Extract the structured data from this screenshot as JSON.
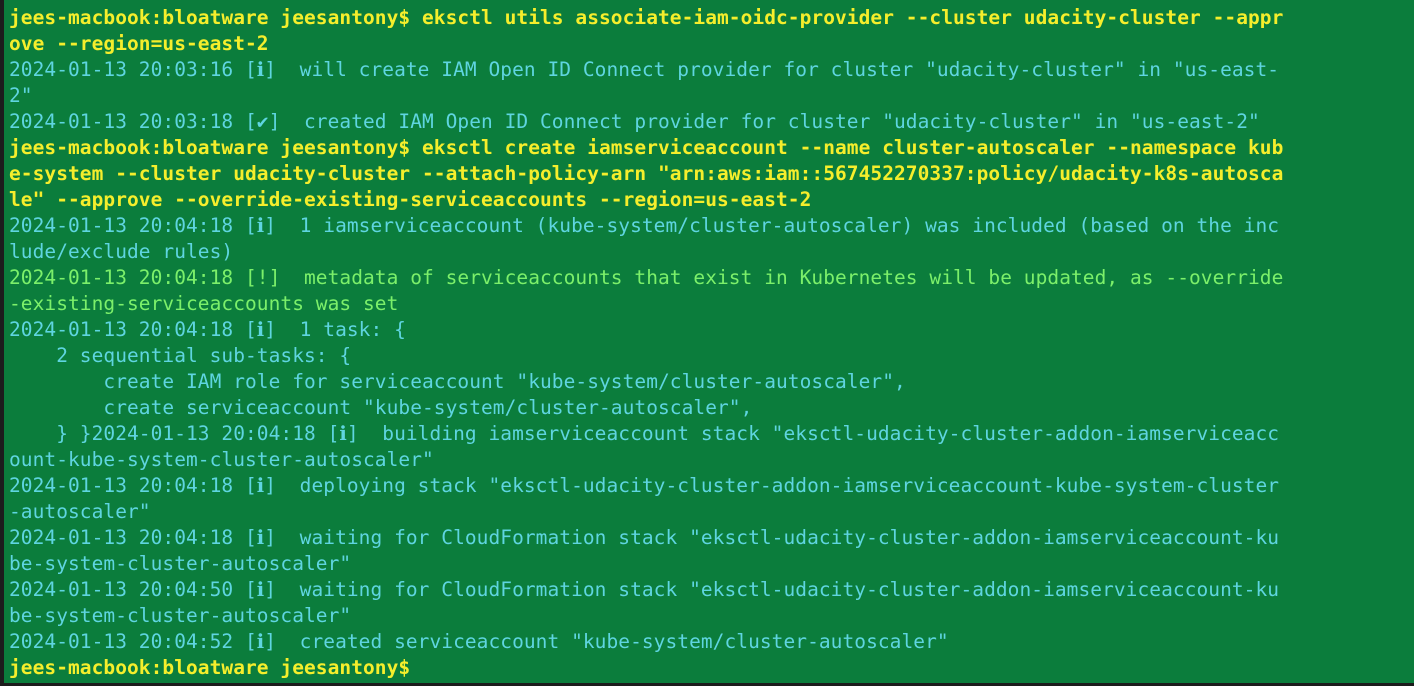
{
  "window": {
    "top_fragment": "___ _ _______"
  },
  "colors": {
    "background": "#0b7d3c",
    "prompt": "#f5ee2c",
    "info": "#5fd5e0",
    "warning": "#7cf06a"
  },
  "lines": [
    {
      "type": "prompt",
      "prompt": "jees-macbook:bloatware jeesantony$ ",
      "text": "eksctl utils associate-iam-oidc-provider --cluster udacity-cluster --appr"
    },
    {
      "type": "prompt",
      "prompt": "",
      "text": "ove --region=us-east-2"
    },
    {
      "type": "info",
      "text": "2024-01-13 20:03:16 [ℹ]  will create IAM Open ID Connect provider for cluster \"udacity-cluster\" in \"us-east-"
    },
    {
      "type": "info",
      "text": "2\""
    },
    {
      "type": "info",
      "text": "2024-01-13 20:03:18 [✔]  created IAM Open ID Connect provider for cluster \"udacity-cluster\" in \"us-east-2\""
    },
    {
      "type": "prompt",
      "prompt": "jees-macbook:bloatware jeesantony$ ",
      "text": "eksctl create iamserviceaccount --name cluster-autoscaler --namespace kub"
    },
    {
      "type": "prompt",
      "prompt": "",
      "text": "e-system --cluster udacity-cluster --attach-policy-arn \"arn:aws:iam::567452270337:policy/udacity-k8s-autosca"
    },
    {
      "type": "prompt",
      "prompt": "",
      "text": "le\" --approve --override-existing-serviceaccounts --region=us-east-2"
    },
    {
      "type": "info",
      "text": "2024-01-13 20:04:18 [ℹ]  1 iamserviceaccount (kube-system/cluster-autoscaler) was included (based on the inc"
    },
    {
      "type": "info",
      "text": "lude/exclude rules)"
    },
    {
      "type": "warn",
      "text": "2024-01-13 20:04:18 [!]  metadata of serviceaccounts that exist in Kubernetes will be updated, as --override"
    },
    {
      "type": "warn",
      "text": "-existing-serviceaccounts was set"
    },
    {
      "type": "info",
      "text": "2024-01-13 20:04:18 [ℹ]  1 task: {"
    },
    {
      "type": "info",
      "text": "    2 sequential sub-tasks: {"
    },
    {
      "type": "info",
      "text": "        create IAM role for serviceaccount \"kube-system/cluster-autoscaler\","
    },
    {
      "type": "info",
      "text": "        create serviceaccount \"kube-system/cluster-autoscaler\","
    },
    {
      "type": "info",
      "text": "    } }2024-01-13 20:04:18 [ℹ]  building iamserviceaccount stack \"eksctl-udacity-cluster-addon-iamserviceacc"
    },
    {
      "type": "info",
      "text": "ount-kube-system-cluster-autoscaler\""
    },
    {
      "type": "info",
      "text": "2024-01-13 20:04:18 [ℹ]  deploying stack \"eksctl-udacity-cluster-addon-iamserviceaccount-kube-system-cluster"
    },
    {
      "type": "info",
      "text": "-autoscaler\""
    },
    {
      "type": "info",
      "text": "2024-01-13 20:04:18 [ℹ]  waiting for CloudFormation stack \"eksctl-udacity-cluster-addon-iamserviceaccount-ku"
    },
    {
      "type": "info",
      "text": "be-system-cluster-autoscaler\""
    },
    {
      "type": "info",
      "text": "2024-01-13 20:04:50 [ℹ]  waiting for CloudFormation stack \"eksctl-udacity-cluster-addon-iamserviceaccount-ku"
    },
    {
      "type": "info",
      "text": "be-system-cluster-autoscaler\""
    },
    {
      "type": "info",
      "text": "2024-01-13 20:04:52 [ℹ]  created serviceaccount \"kube-system/cluster-autoscaler\""
    },
    {
      "type": "prompt",
      "prompt": "jees-macbook:bloatware jeesantony$ ",
      "text": ""
    }
  ]
}
